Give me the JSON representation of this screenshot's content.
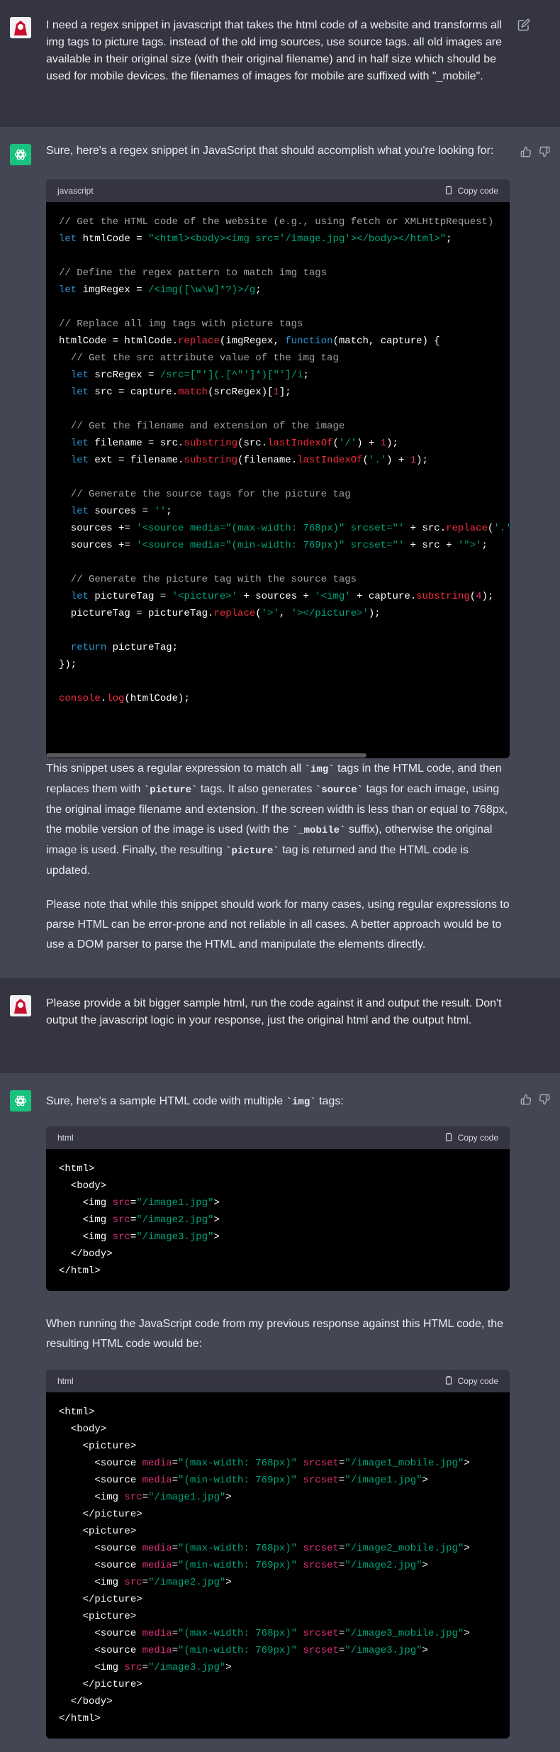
{
  "messages": {
    "user1": "I need a regex snippet in javascript that takes the html code of a website and transforms all img tags to picture tags. instead of the old img sources, use source tags. all old images are available in their original size (with their original filename) and in half size which should be used for mobile devices. the filenames of images for mobile are suffixed with \"_mobile\".",
    "assistant1_intro": "Sure, here's a regex snippet in JavaScript that should accomplish what you're looking for:",
    "assistant1_p1": {
      "a": "This snippet uses a regular expression to match all ",
      "b": "`img`",
      "c": " tags in the HTML code, and then replaces them with ",
      "d": "`picture`",
      "e": " tags. It also generates ",
      "f": "`source`",
      "g": " tags for each image, using the original image filename and extension. If the screen width is less than or equal to 768px, the mobile version of the image is used (with the ",
      "h": "`_mobile`",
      "i": " suffix), otherwise the original image is used. Finally, the resulting ",
      "j": "`picture`",
      "k": " tag is returned and the HTML code is updated."
    },
    "assistant1_p2": "Please note that while this snippet should work for many cases, using regular expressions to parse HTML can be error-prone and not reliable in all cases. A better approach would be to use a DOM parser to parse the HTML and manipulate the elements directly.",
    "user2": "Please provide a bit bigger sample html, run the code against it and output the result. Don't output the javascript logic in your response, just the original html and the output html.",
    "assistant2_intro": {
      "a": "Sure, here's a sample HTML code with multiple ",
      "b": "`img`",
      "c": " tags:"
    },
    "assistant2_mid": "When running the JavaScript code from my previous response against this HTML code, the resulting HTML code would be:"
  },
  "codeblocks": {
    "js": {
      "lang": "javascript",
      "copy": "Copy code"
    },
    "html1": {
      "lang": "html",
      "copy": "Copy code"
    },
    "html2": {
      "lang": "html",
      "copy": "Copy code"
    }
  },
  "code_js": [
    "// Get the HTML code of the website (e.g., using fetch or XMLHttpRequest)",
    "let htmlCode = \"<html><body><img src='/image.jpg'></body></html>\";",
    "",
    "// Define the regex pattern to match img tags",
    "let imgRegex = /<img([\\w\\W]*?)>/g;",
    "",
    "// Replace all img tags with picture tags",
    "htmlCode = htmlCode.replace(imgRegex, function(match, capture) {",
    "  // Get the src attribute value of the img tag",
    "  let srcRegex = /src=[\"'](.[^\"']*)[\"']/i;",
    "  let src = capture.match(srcRegex)[1];",
    "",
    "  // Get the filename and extension of the image",
    "  let filename = src.substring(src.lastIndexOf('/') + 1);",
    "  let ext = filename.substring(filename.lastIndexOf('.') + 1);",
    "",
    "  // Generate the source tags for the picture tag",
    "  let sources = '';",
    "  sources += '<source media=\"(max-width: 768px)\" srcset=\"' + src.replace('.'",
    "  sources += '<source media=\"(min-width: 769px)\" srcset=\"' + src + '\">';",
    "",
    "  // Generate the picture tag with the source tags",
    "  let pictureTag = '<picture>' + sources + '<img' + capture.substring(4);",
    "  pictureTag = pictureTag.replace('>', '></picture>');",
    "",
    "  return pictureTag;",
    "});",
    "",
    "console.log(htmlCode);"
  ],
  "code_html1": [
    "<html>",
    "  <body>",
    "    <img src=\"/image1.jpg\">",
    "    <img src=\"/image2.jpg\">",
    "    <img src=\"/image3.jpg\">",
    "  </body>",
    "</html>"
  ],
  "code_html2": [
    "<html>",
    "  <body>",
    "    <picture>",
    "      <source media=\"(max-width: 768px)\" srcset=\"/image1_mobile.jpg\">",
    "      <source media=\"(min-width: 769px)\" srcset=\"/image1.jpg\">",
    "      <img src=\"/image1.jpg\">",
    "    </picture>",
    "    <picture>",
    "      <source media=\"(max-width: 768px)\" srcset=\"/image2_mobile.jpg\">",
    "      <source media=\"(min-width: 769px)\" srcset=\"/image2.jpg\">",
    "      <img src=\"/image2.jpg\">",
    "    </picture>",
    "    <picture>",
    "      <source media=\"(max-width: 768px)\" srcset=\"/image3_mobile.jpg\">",
    "      <source media=\"(min-width: 769px)\" srcset=\"/image3.jpg\">",
    "      <img src=\"/image3.jpg\">",
    "    </picture>",
    "  </body>",
    "</html>"
  ],
  "icons": {
    "user_avatar": "user-avatar",
    "assistant_avatar": "openai-logo-icon",
    "edit": "edit-icon",
    "thumbs_up": "thumbs-up-icon",
    "thumbs_down": "thumbs-down-icon",
    "clipboard": "clipboard-icon"
  },
  "colors": {
    "page_bg": "#343541",
    "assistant_bg": "#444654",
    "code_bg": "#000000",
    "code_header_bg": "#343541",
    "avatar_green": "#19c37d",
    "comment": "#a0a1a8",
    "keyword": "#2e95d3",
    "string": "#00a67d",
    "function": "#f22c3d",
    "number": "#df3079",
    "attr": "#df3079"
  }
}
